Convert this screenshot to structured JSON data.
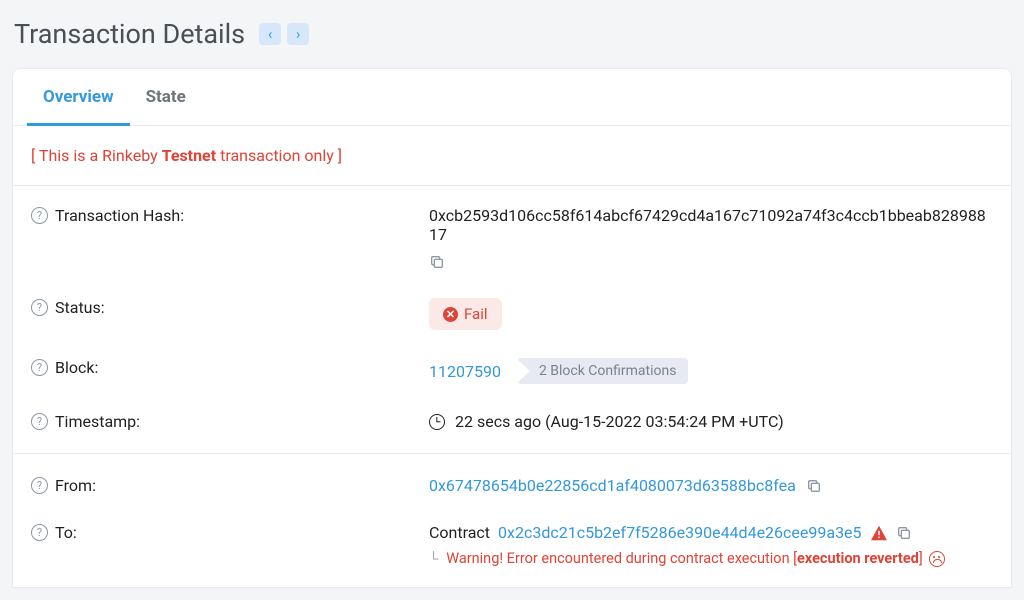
{
  "header": {
    "title": "Transaction Details"
  },
  "tabs": {
    "overview": "Overview",
    "state": "State"
  },
  "notice": {
    "prefix": "[ This is a Rinkeby ",
    "bold": "Testnet",
    "suffix": " transaction only ]"
  },
  "labels": {
    "txhash": "Transaction Hash:",
    "status": "Status:",
    "block": "Block:",
    "timestamp": "Timestamp:",
    "from": "From:",
    "to": "To:"
  },
  "values": {
    "txhash": "0xcb2593d106cc58f614abcf67429cd4a167c71092a74f3c4ccb1bbeab82898817",
    "status": "Fail",
    "block": "11207590",
    "confirmations": "2 Block Confirmations",
    "timestamp": "22 secs ago (Aug-15-2022 03:54:24 PM +UTC)",
    "from": "0x67478654b0e22856cd1af4080073d63588bc8fea",
    "to_prefix": "Contract",
    "to_address": "0x2c3dc21c5b2ef7f5286e390e44d4e26cee99a3e5",
    "warning_prefix": "Warning! Error encountered during contract execution [",
    "warning_bold": "execution reverted",
    "warning_suffix": "]"
  }
}
